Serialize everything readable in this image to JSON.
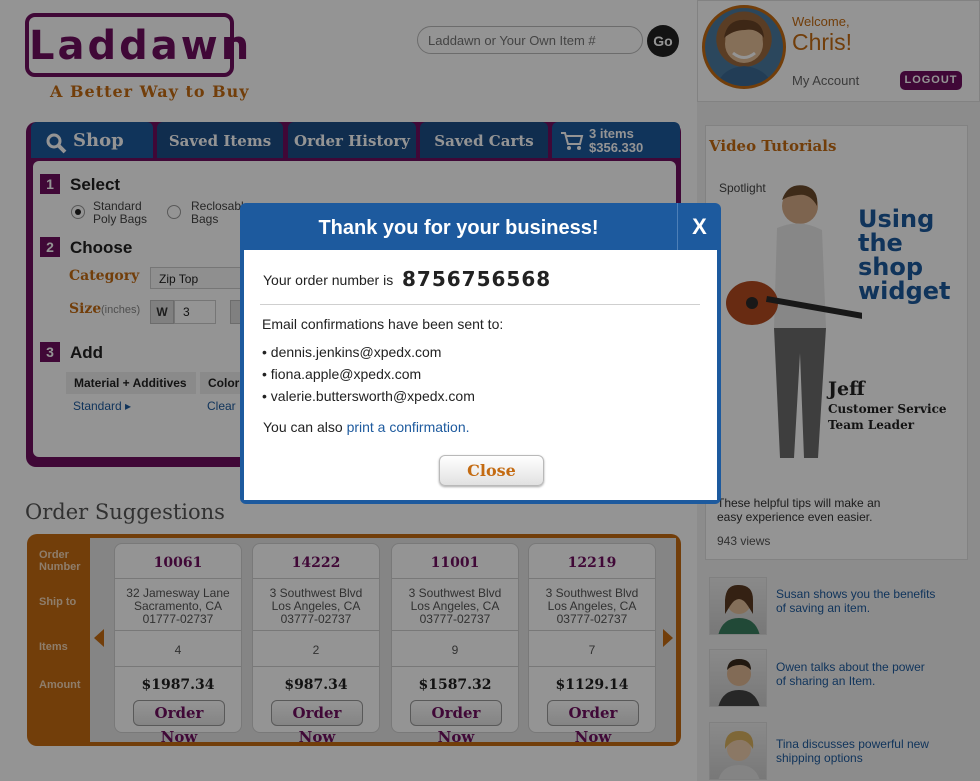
{
  "header": {
    "logo_text": "Laddawn",
    "tagline": "A Better Way to Buy",
    "search_placeholder": "Laddawn or Your Own Item #",
    "go_label": "Go"
  },
  "account": {
    "welcome": "Welcome,",
    "username": "Chris!",
    "my_account": "My Account",
    "logout": "LOGOUT"
  },
  "tabs": [
    {
      "label": "Shop"
    },
    {
      "label": "Saved Items"
    },
    {
      "label": "Order History"
    },
    {
      "label": "Saved Carts"
    }
  ],
  "cart": {
    "items": "3 items",
    "total": "$356.330"
  },
  "shop": {
    "step1": {
      "num": "1",
      "label": "Select"
    },
    "step2": {
      "num": "2",
      "label": "Choose"
    },
    "step3": {
      "num": "3",
      "label": "Add"
    },
    "options": [
      {
        "label": "Standard Poly Bags",
        "line1": "Standard",
        "line2": "Poly Bags",
        "checked": true
      },
      {
        "label": "Reclosable Bags",
        "line1": "Reclosabl",
        "line2": "Bags",
        "checked": false
      }
    ],
    "category_label": "Category",
    "category_value": "Zip Top",
    "size_label": "Size",
    "size_unit": "(inches)",
    "size_w_label": "W",
    "size_w_value": "3",
    "col_material": "Material + Additives",
    "col_color": "Color",
    "link_standard": "Standard ▸",
    "link_clear": "Clear"
  },
  "order_suggestions": {
    "title": "Order Suggestions",
    "row_labels": {
      "order_number": "Order Number",
      "ship_to": "Ship to",
      "items": "Items",
      "amount": "Amount"
    },
    "cards": [
      {
        "number": "10061",
        "addr1": "32 Jamesway Lane",
        "addr2": "Sacramento, CA",
        "addr3": "01777-02737",
        "items": "4",
        "amount": "$1987.34",
        "button": "Order Now"
      },
      {
        "number": "14222",
        "addr1": "3 Southwest Blvd",
        "addr2": "Los Angeles, CA",
        "addr3": "03777-02737",
        "items": "2",
        "amount": "$987.34",
        "button": "Order Now"
      },
      {
        "number": "11001",
        "addr1": "3 Southwest Blvd",
        "addr2": "Los Angeles, CA",
        "addr3": "03777-02737",
        "items": "9",
        "amount": "$1587.32",
        "button": "Order Now"
      },
      {
        "number": "12219",
        "addr1": "3 Southwest Blvd",
        "addr2": "Los Angeles, CA",
        "addr3": "03777-02737",
        "items": "7",
        "amount": "$1129.14",
        "button": "Order Now"
      }
    ]
  },
  "video": {
    "title": "Video Tutorials",
    "spotlight": "Spotlight",
    "promo_lines": [
      "Using",
      "the",
      "shop",
      "widget"
    ],
    "person_name": "Jeff",
    "person_title_1": "Customer Service",
    "person_title_2": "Team Leader",
    "tips_line1": "These helpful tips will make an",
    "tips_line2": "easy experience even easier.",
    "views": "943 views",
    "thumbs": [
      {
        "line1": "Susan shows you the benefits",
        "line2": "of saving an item."
      },
      {
        "line1": "Owen talks about the power",
        "line2": "of sharing an Item."
      },
      {
        "line1": "Tina discusses powerful new",
        "line2": "shipping options"
      }
    ]
  },
  "modal": {
    "title": "Thank you for your business!",
    "close_x": "X",
    "order_prefix": "Your order number is",
    "order_number": "8756756568",
    "email_intro": "Email confirmations have been sent to:",
    "emails": [
      "• dennis.jenkins@xpedx.com",
      "• fiona.apple@xpedx.com",
      "• valerie.buttersworth@xpedx.com"
    ],
    "print_prefix": "You can also",
    "print_link": "print a confirmation.",
    "close_label": "Close"
  },
  "colors": {
    "brand_purple": "#6f0f5f",
    "brand_blue": "#1d5a9e",
    "brand_orange": "#c46b12"
  }
}
